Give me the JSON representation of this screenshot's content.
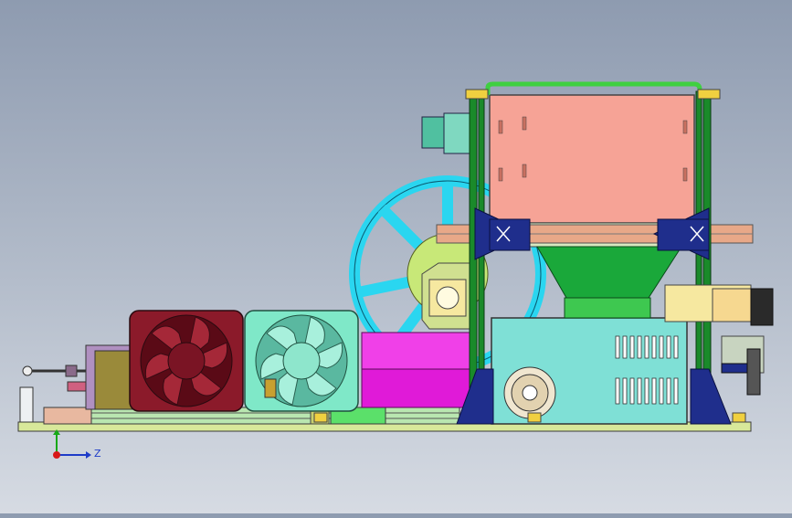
{
  "viewport": {
    "background_top": "#8e9bb0",
    "background_bottom": "#d6dbe3"
  },
  "model": {
    "frame_color": "#1a8a2a",
    "bracket_color": "#1f2e8c",
    "hopper_color": "#f6a396",
    "funnel_color": "#1aa83a",
    "psu_color": "#7fe0d6",
    "fan_left_color": "#8b1a2a",
    "fan_right_color": "#7fe8c8",
    "spool_color": "#2ad6f0",
    "heater_color": "#e01ad8",
    "gearbox_color": "#9a8a3a",
    "base_color": "#d8e89a"
  },
  "triad": {
    "z_label": "Z",
    "x_color": "#d81818",
    "y_color": "#18a818",
    "z_color": "#1e3cc8"
  }
}
